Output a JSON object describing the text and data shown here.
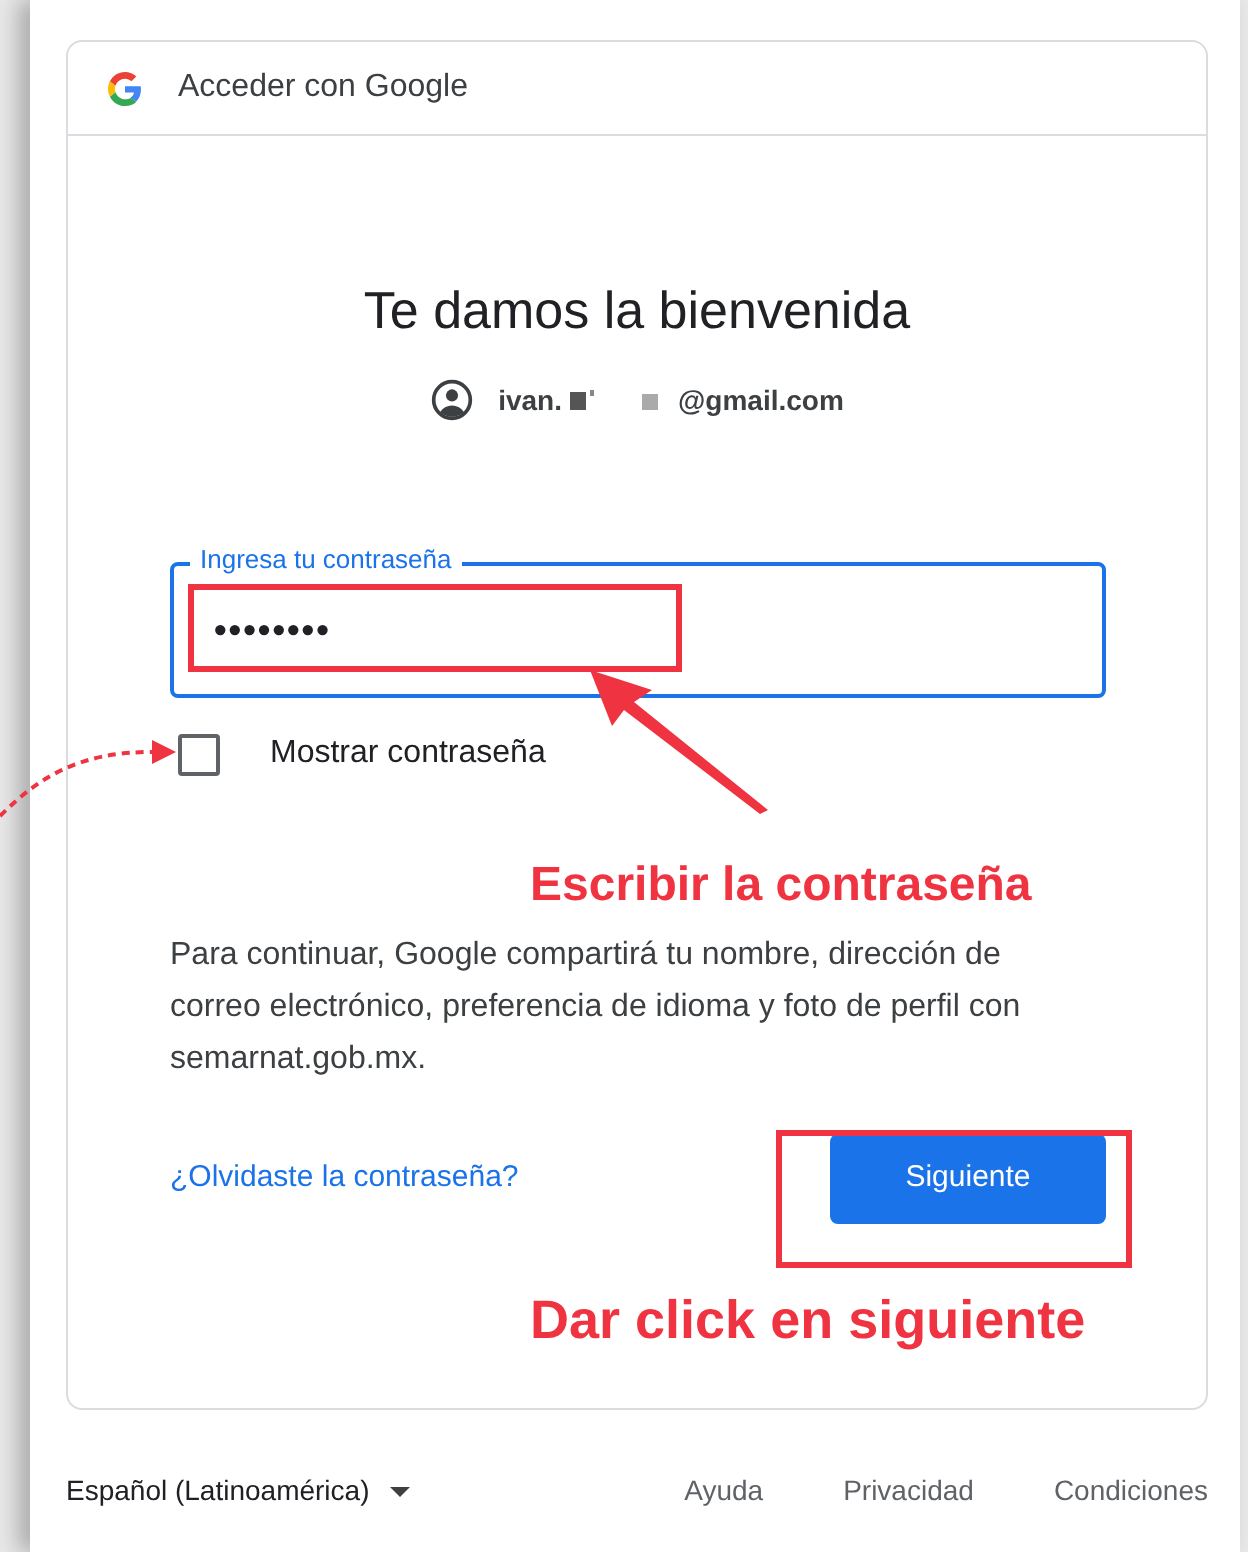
{
  "header": {
    "title": "Acceder con Google"
  },
  "heading": "Te damos la bienvenida",
  "account": {
    "email_start": "ivan.",
    "email_end": "@gmail.com"
  },
  "password": {
    "label": "Ingresa tu contraseña",
    "value": "••••••••"
  },
  "show_password": {
    "label": "Mostrar contraseña",
    "checked": false
  },
  "notice": "Para continuar, Google compartirá tu nombre, dirección de correo electrónico, preferencia de idioma y foto de perfil con semarnat.gob.mx.",
  "forgot_link": "¿Olvidaste la contraseña?",
  "next_button": "Siguiente",
  "annotations": [
    {
      "text": "Escribir la contraseña"
    },
    {
      "text": "Dar click en siguiente"
    }
  ],
  "footer": {
    "language": "Español (Latinoamérica)",
    "links": [
      "Ayuda",
      "Privacidad",
      "Condiciones"
    ]
  }
}
